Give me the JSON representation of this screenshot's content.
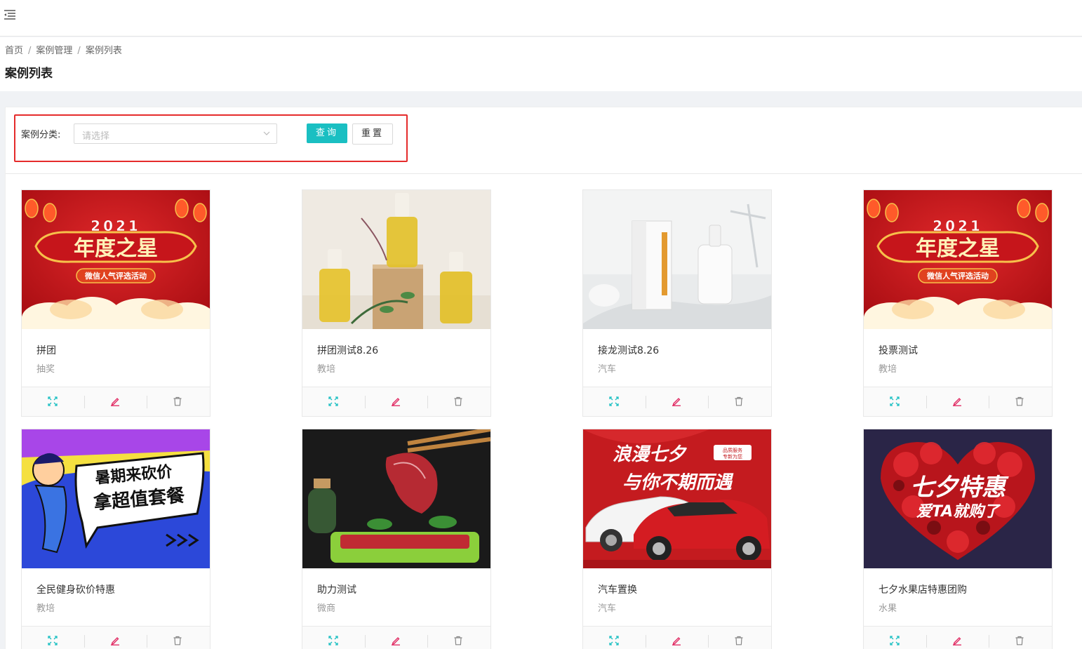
{
  "breadcrumb": {
    "home": "首页",
    "separator": "/",
    "section": "案例管理",
    "current": "案例列表"
  },
  "page_title": "案例列表",
  "filter": {
    "label": "案例分类:",
    "select_placeholder": "请选择",
    "query_button": "查询",
    "reset_button": "重置"
  },
  "colors": {
    "accent": "#1abfc2",
    "highlight_border": "#e52b2b",
    "edit_icon": "#e0245e",
    "view_icon": "#1abfc2"
  },
  "cards": [
    {
      "title": "拼团",
      "category": "抽奖",
      "thumb": "year-star-2021-banner",
      "thumb_text": [
        "2021",
        "年度之星",
        "微信人气评选活动"
      ]
    },
    {
      "title": "拼团测试8.26",
      "category": "教培",
      "thumb": "essential-oil-bottles-photo",
      "thumb_text": []
    },
    {
      "title": "接龙测试8.26",
      "category": "汽车",
      "thumb": "skincare-product-photo",
      "thumb_text": []
    },
    {
      "title": "投票测试",
      "category": "教培",
      "thumb": "year-star-2021-banner",
      "thumb_text": [
        "2021",
        "年度之星",
        "微信人气评选活动"
      ]
    },
    {
      "title": "全民健身砍价特惠",
      "category": "教培",
      "thumb": "summer-bargain-banner",
      "thumb_text": [
        "暑期来砍价",
        "拿超值套餐"
      ]
    },
    {
      "title": "助力测试",
      "category": "微商",
      "thumb": "raw-beef-photo",
      "thumb_text": []
    },
    {
      "title": "汽车置换",
      "category": "汽车",
      "thumb": "qixi-car-banner",
      "thumb_text": [
        "浪漫七夕",
        "与你不期而遇",
        "品质服务",
        "专新为您"
      ]
    },
    {
      "title": "七夕水果店特惠团购",
      "category": "水果",
      "thumb": "qixi-roses-banner",
      "thumb_text": [
        "七夕特惠",
        "爱TA就购了"
      ]
    }
  ],
  "card_actions": [
    "expand-icon",
    "edit-icon",
    "trash-icon"
  ]
}
